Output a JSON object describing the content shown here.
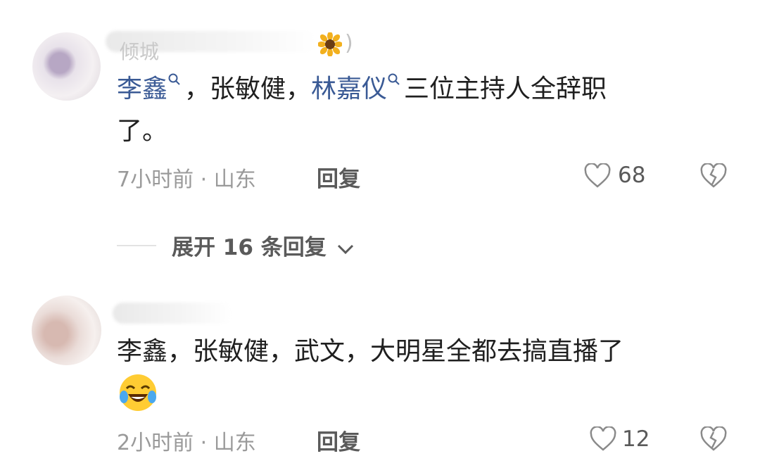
{
  "comments": [
    {
      "username_visible": "倾城",
      "content_parts": {
        "mention1": "李鑫",
        "sep1": "，张敏健，",
        "mention2": "林嘉仪",
        "rest": "三位主持人全辞职",
        "line2": "了。"
      },
      "time_location": "7小时前 · 山东",
      "reply_label": "回复",
      "like_count": "68",
      "expand_replies_label": "展开 16 条回复"
    },
    {
      "content_line1": "李鑫，张敏健，武文，大明星全都去搞直播了",
      "emoji_icon": "laugh-cry-emoji-icon",
      "time_location": "2小时前 · 山东",
      "reply_label": "回复",
      "like_count": "12"
    }
  ],
  "icons": {
    "like": "heart-outline-icon",
    "dislike": "broken-heart-icon",
    "expand": "chevron-down-icon"
  },
  "colors": {
    "mention": "#3a5a95",
    "meta": "#9a9a9a",
    "text": "#1f1f1f"
  }
}
